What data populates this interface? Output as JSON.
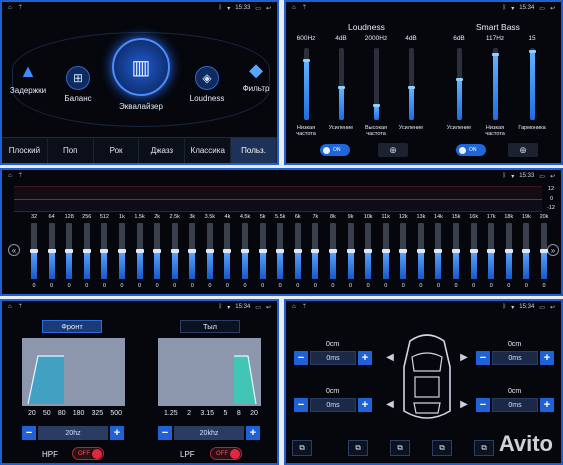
{
  "status": {
    "time_top": "15:33",
    "time_right": "15:34",
    "time_eq": "15:33",
    "time_bottom": "15:34"
  },
  "main_menu": {
    "modes": [
      "Задержки",
      "Баланс",
      "Эквалайзер",
      "Loudness",
      "Фильтр"
    ],
    "presets": [
      "Плоский",
      "Поп",
      "Рок",
      "Джазз",
      "Классика",
      "Польз."
    ],
    "active_preset": 5
  },
  "loudness_panel": {
    "loudness_title": "Loudness",
    "smartbass_title": "Smart Bass",
    "sliders": [
      {
        "top": "600Hz",
        "bottom": "Низкая частота",
        "level": 0.82
      },
      {
        "top": "4dB",
        "bottom": "Усиление",
        "level": 0.45
      },
      {
        "top": "2000Hz",
        "bottom": "Высокая частота",
        "level": 0.2
      },
      {
        "top": "4dB",
        "bottom": "Усиление",
        "level": 0.45
      },
      {
        "top": "6dB",
        "bottom": "Усиление",
        "level": 0.55
      },
      {
        "top": "117Hz",
        "bottom": "Низкая частота",
        "level": 0.9
      },
      {
        "top": "15",
        "bottom": "Гармоника",
        "level": 0.95
      }
    ],
    "on_label": "ON"
  },
  "equalizer": {
    "scale": [
      "12",
      "0",
      "-12"
    ],
    "bands": [
      "32",
      "64",
      "128",
      "256",
      "512",
      "1k",
      "1.5k",
      "2k",
      "2.5k",
      "3k",
      "3.5k",
      "4k",
      "4.5k",
      "5k",
      "5.5k",
      "6k",
      "7k",
      "8k",
      "9k",
      "10k",
      "11k",
      "12k",
      "13k",
      "14k",
      "15k",
      "16k",
      "17k",
      "18k",
      "19k",
      "20k"
    ],
    "values": [
      0,
      0,
      0,
      0,
      0,
      0,
      0,
      0,
      0,
      0,
      0,
      0,
      0,
      0,
      0,
      0,
      0,
      0,
      0,
      0,
      0,
      0,
      0,
      0,
      0,
      0,
      0,
      0,
      0,
      0
    ],
    "value_labels": [
      "0",
      "0",
      "0",
      "0",
      "0",
      "0",
      "0",
      "0",
      "0",
      "0",
      "0",
      "0",
      "0",
      "0",
      "0",
      "0",
      "0",
      "0",
      "0",
      "0",
      "0",
      "0",
      "0",
      "0",
      "0",
      "0",
      "0",
      "0",
      "0",
      "0"
    ]
  },
  "filter_panel": {
    "front_label": "Фронт",
    "rear_label": "Тыл",
    "hpf_freqs": [
      "20",
      "50",
      "80",
      "180",
      "325",
      "500"
    ],
    "lpf_freqs": [
      "1.25",
      "2",
      "3.15",
      "5",
      "8",
      "20"
    ],
    "hpf_value": "20hz",
    "lpf_value": "20khz",
    "hpf_label": "HPF",
    "lpf_label": "LPF",
    "off_label": "OFF",
    "minus": "−",
    "plus": "+"
  },
  "delay_panel": {
    "rows": [
      {
        "cm": "0cm",
        "ms": "0ms"
      },
      {
        "cm": "0cm",
        "ms": "0ms"
      },
      {
        "cm": "0cm",
        "ms": "0ms"
      },
      {
        "cm": "0cm",
        "ms": "0ms"
      }
    ],
    "minus": "−",
    "plus": "+"
  },
  "watermark": "Avito",
  "colors": {
    "accent": "#1e5fd6",
    "panel": "#05070d",
    "off_red": "#e0283f"
  }
}
